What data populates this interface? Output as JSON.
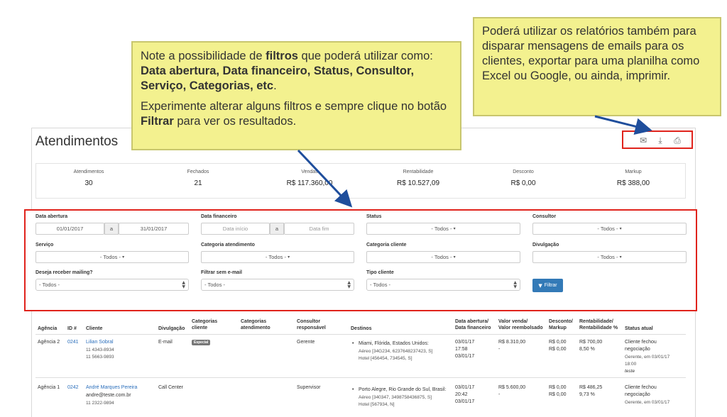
{
  "page": {
    "title": "Atendimentos"
  },
  "toolbar": {
    "icons": [
      "email-icon",
      "download-icon",
      "print-icon"
    ]
  },
  "summary": [
    {
      "label": "Atendimentos",
      "value": "30"
    },
    {
      "label": "Fechados",
      "value": "21"
    },
    {
      "label": "Vendas",
      "value": "R$ 117.360,00"
    },
    {
      "label": "Rentabilidade",
      "value": "R$ 10.527,09"
    },
    {
      "label": "Desconto",
      "value": "R$ 0,00"
    },
    {
      "label": "Markup",
      "value": "R$ 388,00"
    }
  ],
  "filters": {
    "data_abertura": {
      "label": "Data abertura",
      "from": "01/01/2017",
      "sep": "a",
      "to": "31/01/2017"
    },
    "data_financeiro": {
      "label": "Data financeiro",
      "from_placeholder": "Data início",
      "sep": "a",
      "to_placeholder": "Data fim"
    },
    "status": {
      "label": "Status",
      "value": "- Todos -"
    },
    "consultor": {
      "label": "Consultor",
      "value": "- Todos -"
    },
    "servico": {
      "label": "Serviço",
      "value": "- Todos -"
    },
    "categoria_atendimento": {
      "label": "Categoria atendimento",
      "value": "- Todos -"
    },
    "categoria_cliente": {
      "label": "Categoria cliente",
      "value": "- Todos -"
    },
    "divulgacao": {
      "label": "Divulgação",
      "value": "- Todos -"
    },
    "mailing": {
      "label": "Deseja receber mailing?",
      "value": "- Todos -"
    },
    "sem_email": {
      "label": "Filtrar sem e-mail",
      "value": "- Todos -"
    },
    "tipo_cliente": {
      "label": "Tipo cliente",
      "value": "- Todos -"
    },
    "button_label": "Filtrar"
  },
  "table": {
    "headers": {
      "agencia": "Agência",
      "id": "ID #",
      "cliente": "Cliente",
      "divulgacao": "Divulgação",
      "cat_cliente_1": "Categorias",
      "cat_cliente_2": "cliente",
      "cat_atend_1": "Categorias",
      "cat_atend_2": "atendimento",
      "consultor_1": "Consultor",
      "consultor_2": "responsável",
      "destinos": "Destinos",
      "datas_1": "Data abertura/",
      "datas_2": "Data financeiro",
      "valor_1": "Valor venda/",
      "valor_2": "Valor reembolsado",
      "desconto_1": "Desconto/",
      "desconto_2": "Markup",
      "rent_1": "Rentabilidade/",
      "rent_2": "Rentabilidade %",
      "status": "Status atual"
    },
    "rows": [
      {
        "agencia": "Agência 2",
        "id": "0241",
        "cliente": "Lilian Sobral",
        "cliente_l2": "11 4343-8934",
        "cliente_l3": "11 5663-9893",
        "divulgacao": "E-mail",
        "categoria": "Especial",
        "consultor": "Gerente",
        "destino": "Miami, Flórida, Estados Unidos:",
        "destino_l2": "Aéreo [34G234, 6237648237423, S]",
        "destino_l3": "Hotel [456454, 734545, S]",
        "data_l1": "03/01/17",
        "data_l2": "17:58",
        "data_l3": "03/01/17",
        "valor_l1": "R$ 8.310,00",
        "valor_l2": "-",
        "desc_l1": "R$ 0,00",
        "desc_l2": "R$ 0,00",
        "rent_l1": "R$ 700,00",
        "rent_l2": "8,50 %",
        "status_l1": "Cliente fechou",
        "status_l2": "negociação",
        "status_l3": "Gerente, em 03/01/17",
        "status_l4": "18:00",
        "status_l5": "teste"
      },
      {
        "agencia": "Agência 1",
        "id": "0242",
        "cliente": "André Marques Pereira",
        "cliente_l2": "andre@teste.com.br",
        "cliente_l3": "11 2322-9894",
        "divulgacao": "Call Center",
        "consultor": "Supervisor",
        "destino": "Porto Alegre, Rio Grande do Sul, Brasil:",
        "destino_l2": "Aéreo [340347, 3498758436875, S]",
        "destino_l3": "Hotel [567934, N]",
        "data_l1": "03/01/17",
        "data_l2": "20:42",
        "data_l3": "03/01/17",
        "valor_l1": "R$ 5.600,00",
        "valor_l2": "-",
        "desc_l1": "R$ 0,00",
        "desc_l2": "R$ 0,00",
        "rent_l1": "R$ 486,25",
        "rent_l2": "9,73 %",
        "status_l1": "Cliente fechou",
        "status_l2": "negociação",
        "status_l3": "Gerente, em 03/01/17"
      }
    ]
  },
  "callouts": {
    "filters": {
      "p1_a": "Note a possibilidade de ",
      "p1_b": "filtros",
      "p1_c": " que poderá utilizar como: ",
      "p1_d": "Data abertura, Data financeiro, Status, Consultor, Serviço, Categorias, etc",
      "p1_e": ".",
      "p2_a": "Experimente alterar alguns filtros e sempre clique no botão ",
      "p2_b": "Filtrar",
      "p2_c": " para ver os resultados."
    },
    "reports": "Poderá utilizar os relatórios também para disparar mensagens de emails para os clientes, exportar para uma planilha como Excel ou Google, ou ainda, imprimir."
  }
}
